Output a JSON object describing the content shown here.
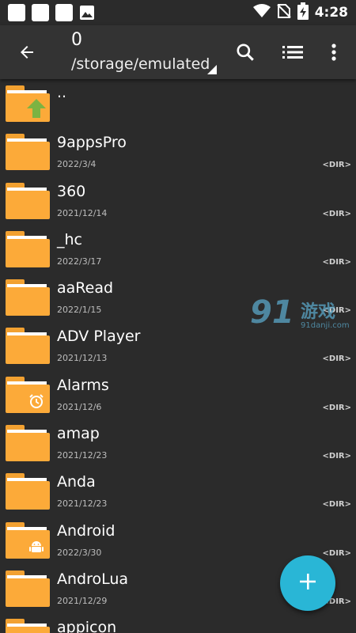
{
  "status_bar": {
    "time": "4:28",
    "icons": [
      "notification-square-icon",
      "notification-square-icon",
      "notification-square-icon",
      "image-icon",
      "wifi-icon",
      "no-sim-icon",
      "battery-charging-icon"
    ]
  },
  "toolbar": {
    "count": "0",
    "path": "/storage/emulated",
    "icons": [
      "back-arrow-icon",
      "search-icon",
      "list-view-icon",
      "more-vert-icon"
    ]
  },
  "files": [
    {
      "name": "..",
      "date": "",
      "tag": "",
      "emblem": "up-arrow"
    },
    {
      "name": "9appsPro",
      "date": "2022/3/4",
      "tag": "<DIR>",
      "emblem": ""
    },
    {
      "name": "360",
      "date": "2021/12/14",
      "tag": "<DIR>",
      "emblem": ""
    },
    {
      "name": "_hc",
      "date": "2022/3/17",
      "tag": "<DIR>",
      "emblem": ""
    },
    {
      "name": "aaRead",
      "date": "2022/1/15",
      "tag": "<DIR>",
      "emblem": ""
    },
    {
      "name": "ADV Player",
      "date": "2021/12/13",
      "tag": "<DIR>",
      "emblem": ""
    },
    {
      "name": "Alarms",
      "date": "2021/12/6",
      "tag": "<DIR>",
      "emblem": "alarm"
    },
    {
      "name": "amap",
      "date": "2021/12/23",
      "tag": "<DIR>",
      "emblem": ""
    },
    {
      "name": "Anda",
      "date": "2021/12/23",
      "tag": "<DIR>",
      "emblem": ""
    },
    {
      "name": "Android",
      "date": "2022/3/30",
      "tag": "<DIR>",
      "emblem": "android"
    },
    {
      "name": "AndroLua",
      "date": "2021/12/29",
      "tag": "<DIR>",
      "emblem": ""
    },
    {
      "name": "appicon",
      "date": "",
      "tag": "",
      "emblem": ""
    }
  ],
  "watermark": {
    "number": "91",
    "chinese": "游戏",
    "url": "91danji.com"
  },
  "fab": {
    "icon": "plus-icon"
  },
  "colors": {
    "background": "#2b2b2b",
    "toolbar": "#333333",
    "folder": "#fcaa39",
    "up_arrow": "#7cb342",
    "fab": "#29b6d6"
  }
}
